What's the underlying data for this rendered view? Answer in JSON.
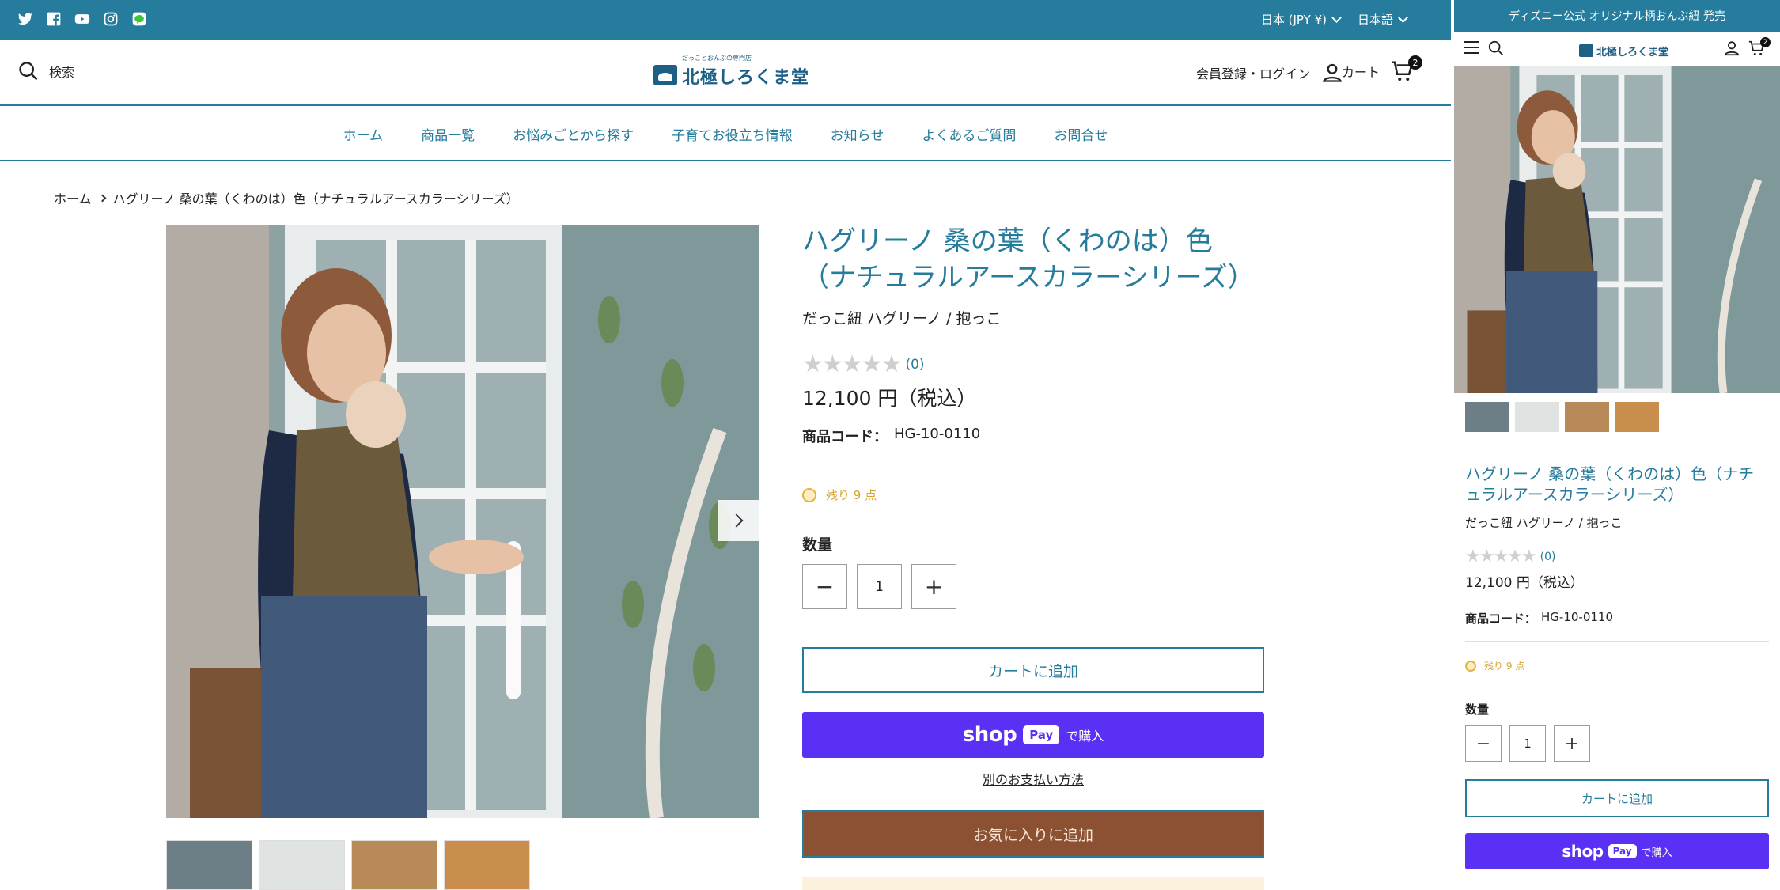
{
  "colors": {
    "brand": "#257c9c",
    "shop_pay": "#5a31f4",
    "favorite": "#8c5133",
    "stock": "#d5a532"
  },
  "topbar": {
    "social_icons": [
      "twitter-icon",
      "facebook-icon",
      "youtube-icon",
      "instagram-icon",
      "line-icon"
    ],
    "currency": "日本 (JPY ¥)",
    "language": "日本語"
  },
  "header": {
    "search_label": "検索",
    "logo_tagline": "だっことおんぶの専門店",
    "logo_text": "北極しろくま堂",
    "account_label": "会員登録・ログイン",
    "cart_label": "カート",
    "cart_count": "2"
  },
  "nav": [
    "ホーム",
    "商品一覧",
    "お悩みごとから探す",
    "子育てお役立ち情報",
    "お知らせ",
    "よくあるご質問",
    "お問合せ"
  ],
  "breadcrumb": {
    "home": "ホーム",
    "current": "ハグリーノ 桑の葉（くわのは）色（ナチュラルアースカラーシリーズ）"
  },
  "product": {
    "title": "ハグリーノ 桑の葉（くわのは）色（ナチュラルアースカラーシリーズ）",
    "vendor": "だっこ紐 ハグリーノ / 抱っこ",
    "stars": "★★★★★",
    "review_count": "(0)",
    "price": "12,100 円（税込）",
    "sku_label": "商品コード：",
    "sku": "HG-10-0110",
    "stock": "残り 9 点",
    "qty_label": "数量",
    "qty_value": "1",
    "minus": "−",
    "plus": "+",
    "add_to_cart": "カートに追加",
    "shop_pay_word": "shop",
    "shop_pay_pill": "Pay",
    "shop_pay_buy": "で購入",
    "alt_payment": "別のお支払い方法",
    "add_favorite": "お気に入りに追加"
  },
  "mobile": {
    "announcement": "ディズニー公式 オリジナル柄おんぶ紐 発売",
    "logo_text": "北極しろくま堂",
    "cart_count": "2"
  }
}
